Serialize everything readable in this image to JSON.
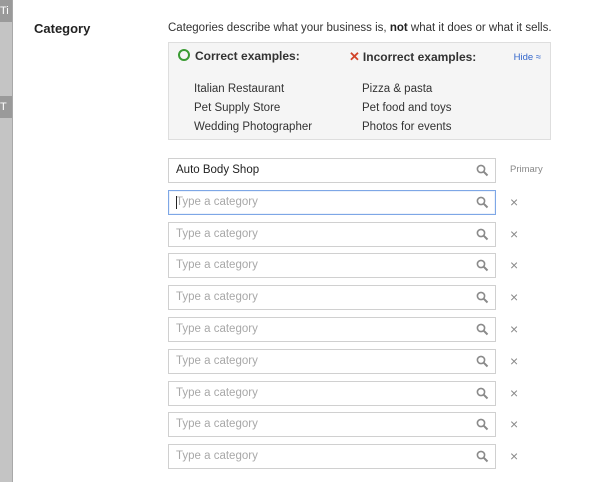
{
  "backdrop": {
    "fragment_1": "Ti",
    "fragment_2": "T"
  },
  "category": {
    "label": "Category",
    "description_pre": "Categories describe what your business is, ",
    "description_bold": "not",
    "description_post": " what it does or what it sells.",
    "examples": {
      "correct_heading": "Correct examples:",
      "incorrect_heading": "Incorrect examples:",
      "hide_label": "Hide ≈",
      "correct": [
        "Italian Restaurant",
        "Pet Supply Store",
        "Wedding Photographer"
      ],
      "incorrect": [
        "Pizza & pasta",
        "Pet food and toys",
        "Photos for events"
      ]
    },
    "primary_value": "Auto Body Shop",
    "primary_label": "Primary",
    "placeholder": "Type a category",
    "remove_symbol": "×",
    "additional_count": 9
  },
  "colors": {
    "correct": "#3a9b33",
    "incorrect": "#d2442a",
    "link": "#3366cc",
    "focus_border": "#7ea7e6"
  }
}
